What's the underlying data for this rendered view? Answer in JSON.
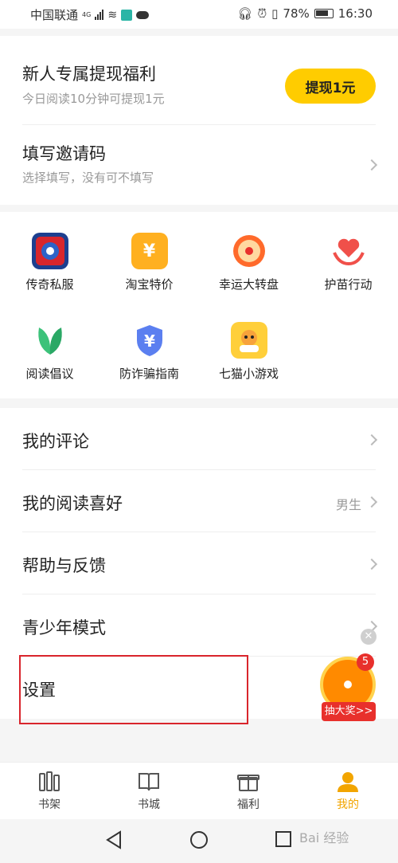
{
  "status": {
    "carrier": "中国联通",
    "network": "4G",
    "battery": "78%",
    "time": "16:30"
  },
  "withdraw": {
    "title": "新人专属提现福利",
    "subtitle": "今日阅读10分钟可提现1元",
    "button": "提现1元"
  },
  "invite": {
    "title": "填写邀请码",
    "subtitle": "选择填写，没有可不填写"
  },
  "tiles": [
    {
      "label": "传奇私服",
      "icon": "legend-game-icon"
    },
    {
      "label": "淘宝特价",
      "icon": "taobao-coupon-icon"
    },
    {
      "label": "幸运大转盘",
      "icon": "lucky-wheel-icon"
    },
    {
      "label": "护苗行动",
      "icon": "heart-hands-icon"
    },
    {
      "label": "阅读倡议",
      "icon": "leaf-icon"
    },
    {
      "label": "防诈骗指南",
      "icon": "shield-yuan-icon"
    },
    {
      "label": "七猫小游戏",
      "icon": "cat-gamepad-icon"
    }
  ],
  "menu": {
    "comments": "我的评论",
    "preference": "我的阅读喜好",
    "preference_value": "男生",
    "help": "帮助与反馈",
    "youth": "青少年模式",
    "settings": "设置"
  },
  "floating": {
    "badge": "5",
    "label": "抽大奖>>"
  },
  "tabs": [
    {
      "label": "书架",
      "icon": "bookshelf-icon"
    },
    {
      "label": "书城",
      "icon": "book-icon"
    },
    {
      "label": "福利",
      "icon": "gift-icon"
    },
    {
      "label": "我的",
      "icon": "user-icon"
    }
  ],
  "watermark": "Bai 经验",
  "colors": {
    "accent": "#ffcc00",
    "active_tab": "#f2a500",
    "highlight": "#d9252c"
  }
}
